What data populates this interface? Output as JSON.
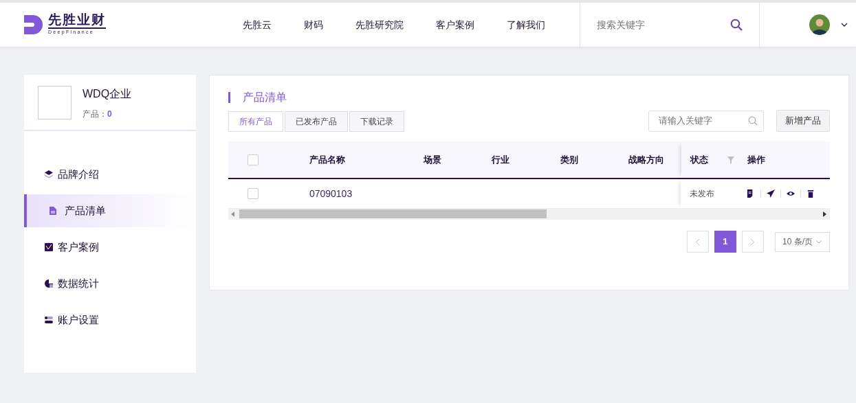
{
  "header": {
    "logo": {
      "title": "先胜业财",
      "subtitle": "DeepFinance"
    },
    "nav": [
      {
        "label": "先胜云"
      },
      {
        "label": "财码"
      },
      {
        "label": "先胜研究院"
      },
      {
        "label": "客户案例"
      },
      {
        "label": "了解我们"
      }
    ],
    "search": {
      "placeholder": "搜索关键字"
    }
  },
  "sidebar": {
    "company": {
      "name": "WDQ企业",
      "products_label": "产品：",
      "products_count": "0"
    },
    "items": [
      {
        "label": "品牌介绍",
        "selected": false
      },
      {
        "label": "产品清单",
        "selected": true
      },
      {
        "label": "客户案例",
        "selected": false
      },
      {
        "label": "数据统计",
        "selected": false
      },
      {
        "label": "账户设置",
        "selected": false
      }
    ]
  },
  "main": {
    "title": "产品清单",
    "tabs": [
      {
        "label": "所有产品",
        "selected": true
      },
      {
        "label": "已发布产品",
        "selected": false
      },
      {
        "label": "下载记录",
        "selected": false
      }
    ],
    "search": {
      "placeholder": "请输入关键字"
    },
    "add_button": "新增产品",
    "table": {
      "select_all_checked": false,
      "columns": [
        "产品名称",
        "场景",
        "行业",
        "类别",
        "战略方向"
      ],
      "fixed_columns": [
        "状态",
        "操作"
      ],
      "rows": [
        {
          "checked": false,
          "name": "07090103",
          "status": "未发布"
        }
      ]
    },
    "pagination": {
      "pages": [
        {
          "label": "1",
          "selected": true
        }
      ],
      "page_size": "10 条/页"
    }
  }
}
